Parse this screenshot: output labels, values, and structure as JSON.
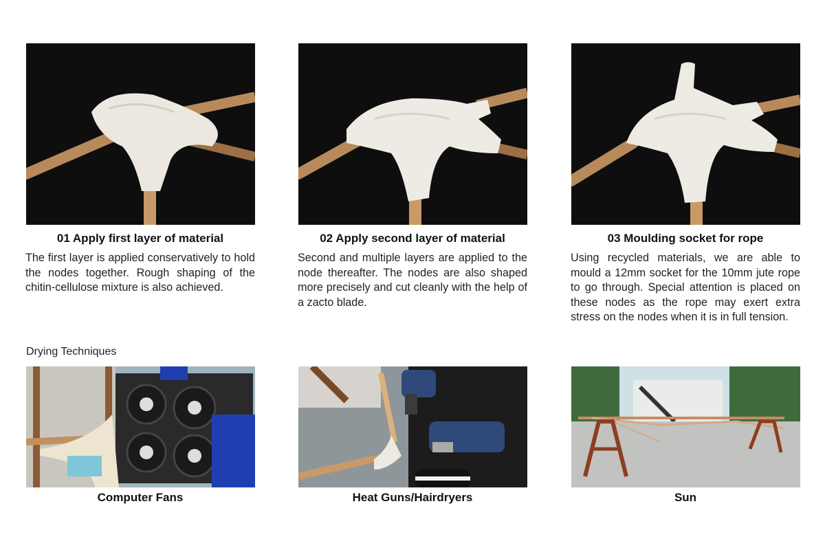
{
  "steps": [
    {
      "title": "01 Apply first layer of material",
      "body": "The first layer is applied conservatively to hold the nodes together. Rough shaping of the chitin-cellulose mixture is also achieved.",
      "photo_icon": "photo-node-first-layer"
    },
    {
      "title": "02 Apply second layer of material",
      "body": "Second and multiple layers are applied to the node thereafter. The nodes are also shaped more precisely and cut cleanly with the help of a zacto blade.",
      "photo_icon": "photo-node-second-layer"
    },
    {
      "title": "03 Moulding socket for rope",
      "body": "Using recycled materials, we are able to mould a 12mm socket for the 10mm jute rope to go through. Special attention is placed on these nodes as the rope may exert extra stress on the nodes when it is in full tension.",
      "photo_icon": "photo-node-rope-socket"
    }
  ],
  "drying": {
    "heading": "Drying Techniques",
    "items": [
      {
        "caption": "Computer Fans",
        "photo_icon": "photo-computer-fans"
      },
      {
        "caption": "Heat Guns/Hairdryers",
        "photo_icon": "photo-heat-guns"
      },
      {
        "caption": "Sun",
        "photo_icon": "photo-sun-outdoor"
      }
    ]
  },
  "colors": {
    "photo_background": "#0d0d0d",
    "bamboo": "#b7895a",
    "node_material": "#ece8e0",
    "text": "#1a1a1a"
  }
}
